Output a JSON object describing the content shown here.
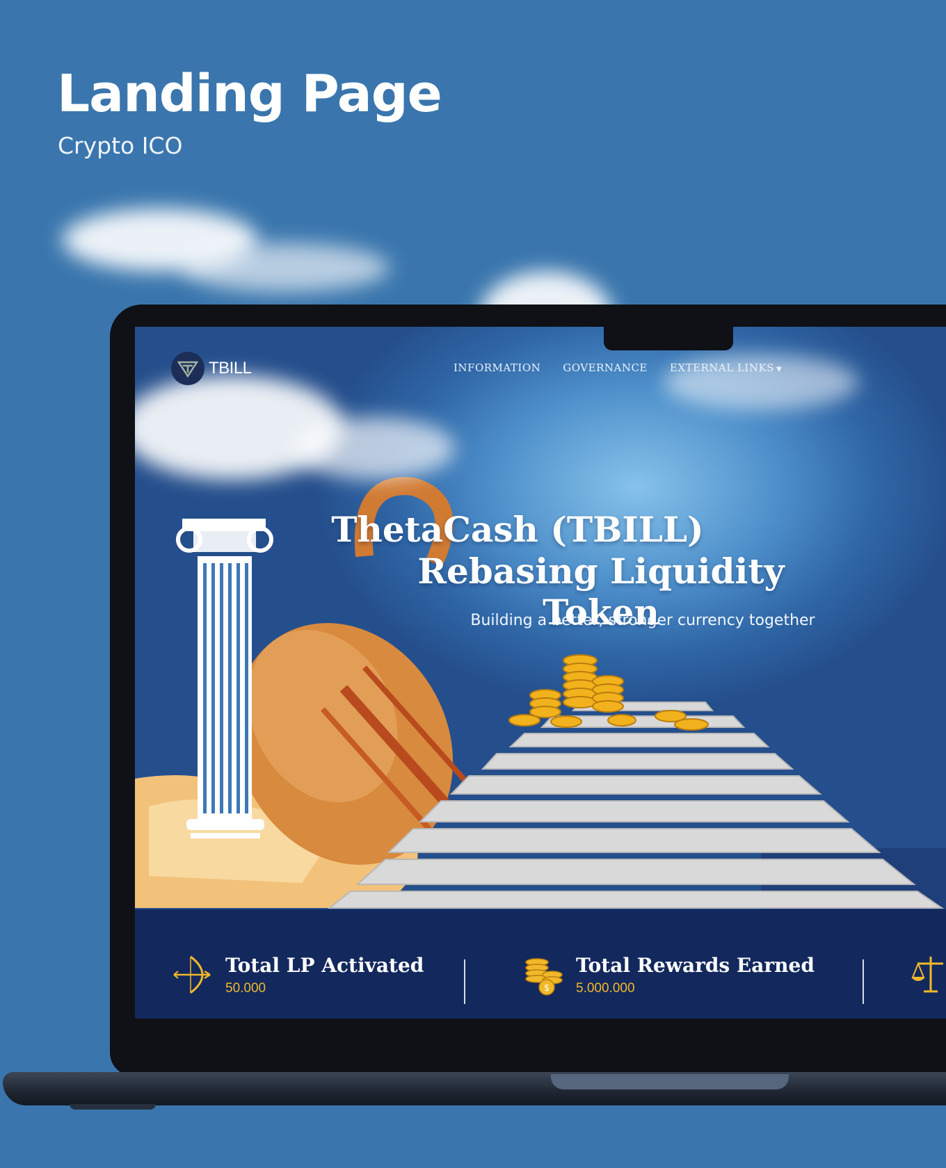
{
  "header": {
    "title": "Landing Page",
    "subtitle": "Crypto ICO"
  },
  "site": {
    "logo_text": "TBILL",
    "nav": {
      "information": "INFORMATION",
      "governance": "GOVERNANCE",
      "external_links": "EXTERNAL LINKS"
    },
    "hero": {
      "title_line1": "ThetaCash (TBILL)",
      "title_line2": "Rebasing Liquidity Token",
      "subtitle": "Building a better, stronger currency together"
    },
    "stats": [
      {
        "label": "Total LP Activated",
        "value": "50.000",
        "icon": "bow-arrow-icon"
      },
      {
        "label": "Total Rewards Earned",
        "value": "5.000.000",
        "icon": "coins-icon"
      },
      {
        "label": "",
        "value": "",
        "icon": "scales-icon"
      }
    ]
  },
  "colors": {
    "page_background": "#3a76ad",
    "stats_bar": "#13295d",
    "stat_value": "#f1b92a",
    "logo_badge": "#1c2e58"
  }
}
